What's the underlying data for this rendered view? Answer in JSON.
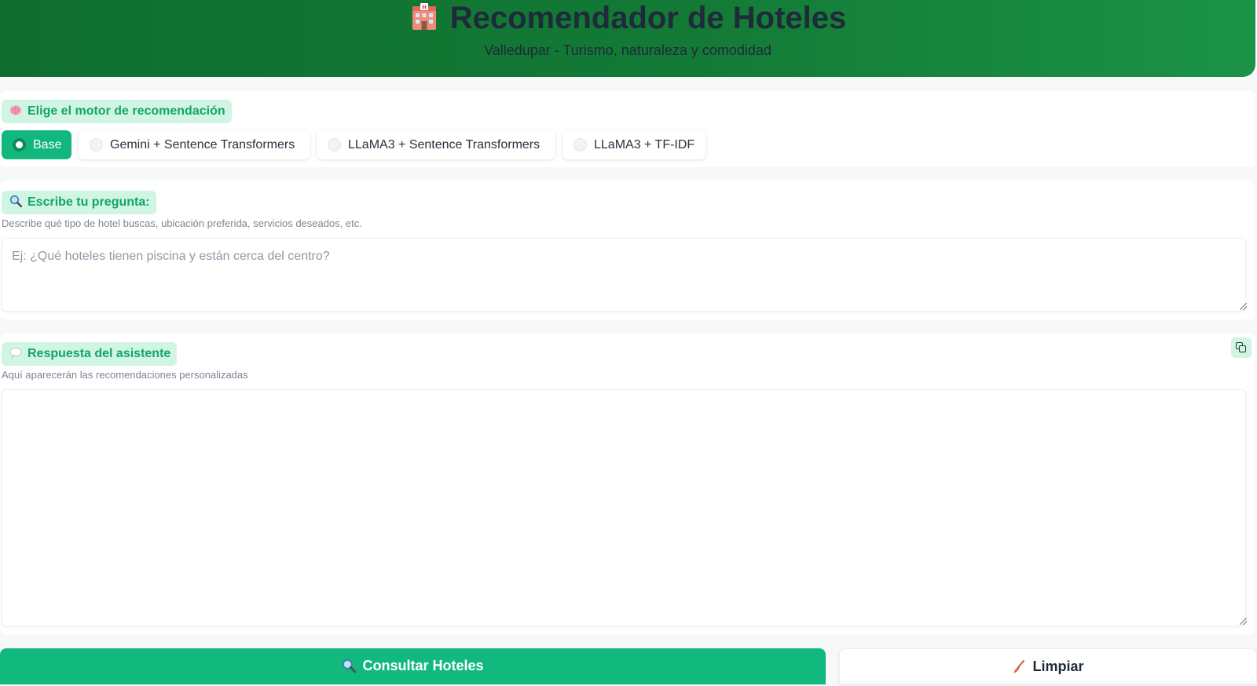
{
  "header": {
    "title": "Recomendador de Hoteles",
    "subtitle": "Valledupar - Turismo, naturaleza y comodidad",
    "icon": "hotel-icon"
  },
  "engine": {
    "label": "Elige el motor de recomendación",
    "icon": "brain-icon",
    "options": [
      {
        "label": "Base",
        "selected": true
      },
      {
        "label": "Gemini + Sentence Transformers",
        "selected": false
      },
      {
        "label": "LLaMA3 + Sentence Transformers",
        "selected": false
      },
      {
        "label": "LLaMA3 + TF-IDF",
        "selected": false
      }
    ]
  },
  "question": {
    "label": "Escribe tu pregunta:",
    "icon": "search-icon",
    "hint": "Describe qué tipo de hotel buscas, ubicación preferida, servicios deseados, etc.",
    "placeholder": "Ej: ¿Qué hoteles tienen piscina y están cerca del centro?",
    "value": ""
  },
  "answer": {
    "label": "Respuesta del asistente",
    "icon": "speech-bubble-icon",
    "hint": "Aquí aparecerán las recomendaciones personalizadas",
    "value": "",
    "copy_icon": "copy-icon"
  },
  "actions": {
    "consultar_label": "Consultar Hoteles",
    "consultar_icon": "search-icon",
    "limpiar_label": "Limpiar",
    "limpiar_icon": "broom-icon"
  },
  "colors": {
    "header_green": "#137a36",
    "accent": "#12b77d",
    "chip_bg": "#d1f5e3",
    "chip_text": "#12a56a"
  }
}
